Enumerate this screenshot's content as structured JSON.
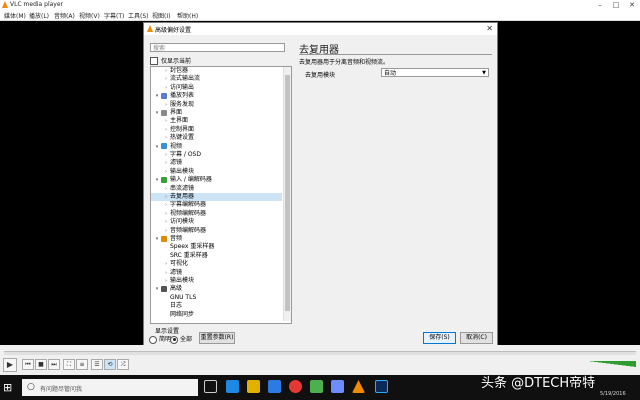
{
  "vlc": {
    "title": "VLC media player",
    "menu": [
      "媒体(M)",
      "播放(L)",
      "音频(A)",
      "视频(V)",
      "字幕(T)",
      "工具(S)",
      "视图(I)",
      "帮助(H)"
    ]
  },
  "dialog": {
    "title": "高级偏好设置",
    "search_placeholder": "搜索",
    "only_current_label": "仅显示当前",
    "tree": [
      {
        "label": "封包器",
        "level": 2,
        "icon": ""
      },
      {
        "label": "流式输出流",
        "level": 2,
        "icon": ""
      },
      {
        "label": "访问输出",
        "level": 2,
        "icon": ""
      },
      {
        "label": "播放列表",
        "level": 1,
        "icon": "playlist-icon"
      },
      {
        "label": "服务发现",
        "level": 2,
        "icon": ""
      },
      {
        "label": "界面",
        "level": 1,
        "icon": "interface-icon"
      },
      {
        "label": "主界面",
        "level": 2,
        "icon": ""
      },
      {
        "label": "控制界面",
        "level": 2,
        "icon": ""
      },
      {
        "label": "热键设置",
        "level": 2,
        "icon": ""
      },
      {
        "label": "视频",
        "level": 1,
        "icon": "video-icon"
      },
      {
        "label": "字幕 / OSD",
        "level": 2,
        "icon": ""
      },
      {
        "label": "滤镜",
        "level": 2,
        "icon": ""
      },
      {
        "label": "输出模块",
        "level": 2,
        "icon": ""
      },
      {
        "label": "输入 / 编解码器",
        "level": 1,
        "icon": "input-codec-icon"
      },
      {
        "label": "串流滤镜",
        "level": 2,
        "icon": ""
      },
      {
        "label": "去复用器",
        "level": 2,
        "icon": "",
        "selected": true
      },
      {
        "label": "字幕编解码器",
        "level": 2,
        "icon": ""
      },
      {
        "label": "视频编解码器",
        "level": 2,
        "icon": ""
      },
      {
        "label": "访问模块",
        "level": 2,
        "icon": ""
      },
      {
        "label": "音频编解码器",
        "level": 2,
        "icon": ""
      },
      {
        "label": "音频",
        "level": 1,
        "icon": "audio-icon"
      },
      {
        "label": "Speex 重采样器",
        "level": 3,
        "icon": ""
      },
      {
        "label": "SRC 重采样器",
        "level": 3,
        "icon": ""
      },
      {
        "label": "可视化",
        "level": 2,
        "icon": ""
      },
      {
        "label": "滤镜",
        "level": 2,
        "icon": ""
      },
      {
        "label": "输出模块",
        "level": 2,
        "icon": ""
      },
      {
        "label": "高级",
        "level": 1,
        "icon": "advanced-icon"
      },
      {
        "label": "GNU TLS",
        "level": 3,
        "icon": ""
      },
      {
        "label": "日志",
        "level": 3,
        "icon": ""
      },
      {
        "label": "网络同步",
        "level": 3,
        "icon": ""
      }
    ],
    "show_settings_label": "显示设置",
    "radio_simple": "简明",
    "radio_all": "全部",
    "reset_label": "重置参数(R)",
    "panel_title": "去复用器",
    "panel_desc": "去复用器用于分离音频和视频流。",
    "demux_label": "去复用模块",
    "demux_value": "自动",
    "save_label": "保存(S)",
    "cancel_label": "取消(C)"
  },
  "taskbar": {
    "search_placeholder": "有问题尽管问我",
    "date": "5/19/2016"
  },
  "watermark": "头条 @DTECH帝特"
}
